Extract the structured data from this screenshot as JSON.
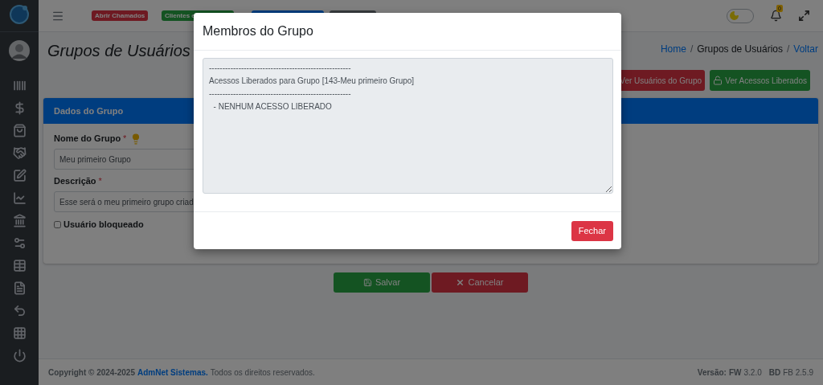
{
  "topbar": {
    "badges": [
      {
        "label": "Abrir Chamados",
        "kind": "danger"
      },
      {
        "label": "Clientes e",
        "kind": "success"
      },
      {
        "kind": "primary"
      },
      {
        "kind": "secondary"
      }
    ],
    "dark_mode": {
      "on": false
    },
    "notifications": {
      "count": "0"
    }
  },
  "page": {
    "title": "Grupos de Usuários",
    "breadcrumb": [
      {
        "label": "Home",
        "link": true
      },
      {
        "separator": "/",
        "label": "Grupos de Usuários",
        "link": false
      },
      {
        "separator": "/",
        "label": "Voltar",
        "link": true
      }
    ],
    "actions": [
      {
        "label": "Ver Usuários do Grupo",
        "kind": "danger"
      },
      {
        "label": "Ver Acessos Liberados",
        "kind": "success"
      }
    ]
  },
  "card": {
    "title": "Dados do Grupo",
    "fields": [
      {
        "label": "Nome do Grupo",
        "required_mark": "*",
        "hint": true,
        "value": "Meu primeiro Grupo"
      },
      {
        "label": "Descrição",
        "required_mark": "*",
        "hint": false,
        "value": "Esse será o meu primeiro grupo criad"
      }
    ],
    "checkbox": {
      "label": "Usuário bloqueado",
      "checked": false
    }
  },
  "form_buttons": [
    {
      "label": "Salvar",
      "kind": "success"
    },
    {
      "label": "Cancelar",
      "kind": "danger"
    }
  ],
  "footer": {
    "copyright": "Copyright © 2024-2025",
    "company": "AdmNet Sistemas.",
    "rights": "Todos os direitos reservados.",
    "version_label": "Versão:",
    "fw_label": "FW",
    "fw": "3.2.0",
    "bd_label": "BD",
    "bd": "FB 2.5.9"
  },
  "modal": {
    "title": "Membros do Grupo",
    "lines": [
      "-----------------------------------------------------",
      "Acessos Liberados para Grupo [143-Meu primeiro Grupo]",
      "-----------------------------------------------------",
      "  - NENHUM ACESSO LIBERADO"
    ],
    "close_button": "Fechar"
  }
}
